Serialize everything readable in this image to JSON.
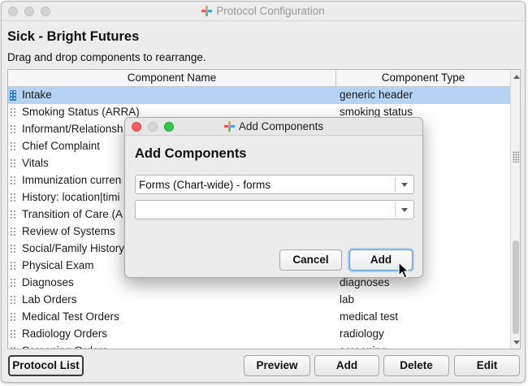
{
  "window": {
    "title": "Protocol Configuration"
  },
  "protocol": {
    "title": "Sick - Bright Futures",
    "instructions": "Drag and drop components to rearrange."
  },
  "table": {
    "columns": [
      "Component Name",
      "Component Type"
    ],
    "rows": [
      {
        "name": "Intake",
        "type": "generic header",
        "selected": true
      },
      {
        "name": "Smoking Status (ARRA)",
        "type": "smoking status"
      },
      {
        "name": "Informant/Relationsh",
        "type": ""
      },
      {
        "name": "Chief Complaint",
        "type": ""
      },
      {
        "name": "Vitals",
        "type": ""
      },
      {
        "name": "Immunization curren",
        "type": ""
      },
      {
        "name": "History: location|timi",
        "type": ""
      },
      {
        "name": "Transition of Care (A",
        "type": ""
      },
      {
        "name": "Review of Systems",
        "type": ""
      },
      {
        "name": "Social/Family History",
        "type": ""
      },
      {
        "name": "Physical Exam",
        "type": ""
      },
      {
        "name": "Diagnoses",
        "type": "diagnoses"
      },
      {
        "name": "Lab Orders",
        "type": "lab"
      },
      {
        "name": "Medical Test Orders",
        "type": "medical test"
      },
      {
        "name": "Radiology Orders",
        "type": "radiology"
      },
      {
        "name": "Screening Orders",
        "type": "screening"
      }
    ]
  },
  "buttons": {
    "protocol_list": "Protocol List",
    "preview": "Preview",
    "add": "Add",
    "delete": "Delete",
    "edit": "Edit"
  },
  "dialog": {
    "title": "Add Components",
    "heading": "Add Components",
    "select1_value": "Forms (Chart-wide) - forms",
    "select2_value": "",
    "cancel_label": "Cancel",
    "add_label": "Add"
  },
  "colors": {
    "selection": "#b4d3f5",
    "accent": "#2a7de1",
    "close": "#fc605c",
    "minimize": "#fdbc40",
    "zoom": "#34c84a"
  },
  "icons": [
    "app-cross-icon",
    "drag-grip-icon",
    "chevron-down-icon",
    "pointer-cursor-icon"
  ]
}
